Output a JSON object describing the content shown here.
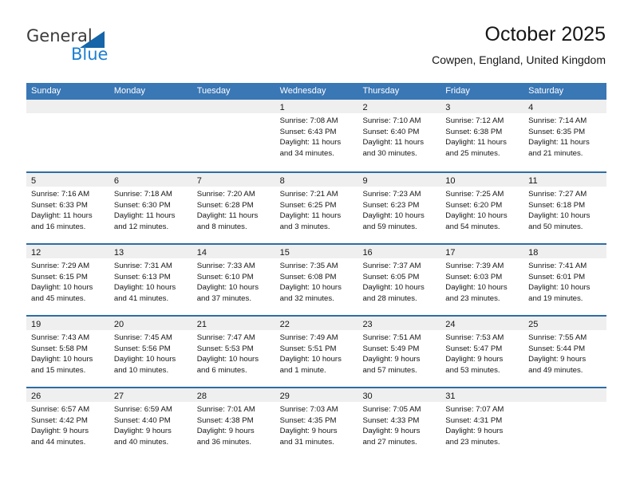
{
  "brand": {
    "line1": "General",
    "line2": "Blue",
    "triangle_color": "#1565a8",
    "blue_color": "#1d7fd0"
  },
  "header": {
    "title": "October 2025",
    "subtitle": "Cowpen, England, United Kingdom"
  },
  "theme": {
    "header_bg": "#3a77b5",
    "row_rule": "#2e6da4",
    "date_band": "#efefef"
  },
  "weekday_headers": [
    "Sunday",
    "Monday",
    "Tuesday",
    "Wednesday",
    "Thursday",
    "Friday",
    "Saturday"
  ],
  "weeks": [
    [
      {
        "day": "",
        "blank": true
      },
      {
        "day": "",
        "blank": true
      },
      {
        "day": "",
        "blank": true
      },
      {
        "day": "1",
        "sunrise": "Sunrise: 7:08 AM",
        "sunset": "Sunset: 6:43 PM",
        "daylight1": "Daylight: 11 hours",
        "daylight2": "and 34 minutes."
      },
      {
        "day": "2",
        "sunrise": "Sunrise: 7:10 AM",
        "sunset": "Sunset: 6:40 PM",
        "daylight1": "Daylight: 11 hours",
        "daylight2": "and 30 minutes."
      },
      {
        "day": "3",
        "sunrise": "Sunrise: 7:12 AM",
        "sunset": "Sunset: 6:38 PM",
        "daylight1": "Daylight: 11 hours",
        "daylight2": "and 25 minutes."
      },
      {
        "day": "4",
        "sunrise": "Sunrise: 7:14 AM",
        "sunset": "Sunset: 6:35 PM",
        "daylight1": "Daylight: 11 hours",
        "daylight2": "and 21 minutes."
      }
    ],
    [
      {
        "day": "5",
        "sunrise": "Sunrise: 7:16 AM",
        "sunset": "Sunset: 6:33 PM",
        "daylight1": "Daylight: 11 hours",
        "daylight2": "and 16 minutes."
      },
      {
        "day": "6",
        "sunrise": "Sunrise: 7:18 AM",
        "sunset": "Sunset: 6:30 PM",
        "daylight1": "Daylight: 11 hours",
        "daylight2": "and 12 minutes."
      },
      {
        "day": "7",
        "sunrise": "Sunrise: 7:20 AM",
        "sunset": "Sunset: 6:28 PM",
        "daylight1": "Daylight: 11 hours",
        "daylight2": "and 8 minutes."
      },
      {
        "day": "8",
        "sunrise": "Sunrise: 7:21 AM",
        "sunset": "Sunset: 6:25 PM",
        "daylight1": "Daylight: 11 hours",
        "daylight2": "and 3 minutes."
      },
      {
        "day": "9",
        "sunrise": "Sunrise: 7:23 AM",
        "sunset": "Sunset: 6:23 PM",
        "daylight1": "Daylight: 10 hours",
        "daylight2": "and 59 minutes."
      },
      {
        "day": "10",
        "sunrise": "Sunrise: 7:25 AM",
        "sunset": "Sunset: 6:20 PM",
        "daylight1": "Daylight: 10 hours",
        "daylight2": "and 54 minutes."
      },
      {
        "day": "11",
        "sunrise": "Sunrise: 7:27 AM",
        "sunset": "Sunset: 6:18 PM",
        "daylight1": "Daylight: 10 hours",
        "daylight2": "and 50 minutes."
      }
    ],
    [
      {
        "day": "12",
        "sunrise": "Sunrise: 7:29 AM",
        "sunset": "Sunset: 6:15 PM",
        "daylight1": "Daylight: 10 hours",
        "daylight2": "and 45 minutes."
      },
      {
        "day": "13",
        "sunrise": "Sunrise: 7:31 AM",
        "sunset": "Sunset: 6:13 PM",
        "daylight1": "Daylight: 10 hours",
        "daylight2": "and 41 minutes."
      },
      {
        "day": "14",
        "sunrise": "Sunrise: 7:33 AM",
        "sunset": "Sunset: 6:10 PM",
        "daylight1": "Daylight: 10 hours",
        "daylight2": "and 37 minutes."
      },
      {
        "day": "15",
        "sunrise": "Sunrise: 7:35 AM",
        "sunset": "Sunset: 6:08 PM",
        "daylight1": "Daylight: 10 hours",
        "daylight2": "and 32 minutes."
      },
      {
        "day": "16",
        "sunrise": "Sunrise: 7:37 AM",
        "sunset": "Sunset: 6:05 PM",
        "daylight1": "Daylight: 10 hours",
        "daylight2": "and 28 minutes."
      },
      {
        "day": "17",
        "sunrise": "Sunrise: 7:39 AM",
        "sunset": "Sunset: 6:03 PM",
        "daylight1": "Daylight: 10 hours",
        "daylight2": "and 23 minutes."
      },
      {
        "day": "18",
        "sunrise": "Sunrise: 7:41 AM",
        "sunset": "Sunset: 6:01 PM",
        "daylight1": "Daylight: 10 hours",
        "daylight2": "and 19 minutes."
      }
    ],
    [
      {
        "day": "19",
        "sunrise": "Sunrise: 7:43 AM",
        "sunset": "Sunset: 5:58 PM",
        "daylight1": "Daylight: 10 hours",
        "daylight2": "and 15 minutes."
      },
      {
        "day": "20",
        "sunrise": "Sunrise: 7:45 AM",
        "sunset": "Sunset: 5:56 PM",
        "daylight1": "Daylight: 10 hours",
        "daylight2": "and 10 minutes."
      },
      {
        "day": "21",
        "sunrise": "Sunrise: 7:47 AM",
        "sunset": "Sunset: 5:53 PM",
        "daylight1": "Daylight: 10 hours",
        "daylight2": "and 6 minutes."
      },
      {
        "day": "22",
        "sunrise": "Sunrise: 7:49 AM",
        "sunset": "Sunset: 5:51 PM",
        "daylight1": "Daylight: 10 hours",
        "daylight2": "and 1 minute."
      },
      {
        "day": "23",
        "sunrise": "Sunrise: 7:51 AM",
        "sunset": "Sunset: 5:49 PM",
        "daylight1": "Daylight: 9 hours",
        "daylight2": "and 57 minutes."
      },
      {
        "day": "24",
        "sunrise": "Sunrise: 7:53 AM",
        "sunset": "Sunset: 5:47 PM",
        "daylight1": "Daylight: 9 hours",
        "daylight2": "and 53 minutes."
      },
      {
        "day": "25",
        "sunrise": "Sunrise: 7:55 AM",
        "sunset": "Sunset: 5:44 PM",
        "daylight1": "Daylight: 9 hours",
        "daylight2": "and 49 minutes."
      }
    ],
    [
      {
        "day": "26",
        "sunrise": "Sunrise: 6:57 AM",
        "sunset": "Sunset: 4:42 PM",
        "daylight1": "Daylight: 9 hours",
        "daylight2": "and 44 minutes."
      },
      {
        "day": "27",
        "sunrise": "Sunrise: 6:59 AM",
        "sunset": "Sunset: 4:40 PM",
        "daylight1": "Daylight: 9 hours",
        "daylight2": "and 40 minutes."
      },
      {
        "day": "28",
        "sunrise": "Sunrise: 7:01 AM",
        "sunset": "Sunset: 4:38 PM",
        "daylight1": "Daylight: 9 hours",
        "daylight2": "and 36 minutes."
      },
      {
        "day": "29",
        "sunrise": "Sunrise: 7:03 AM",
        "sunset": "Sunset: 4:35 PM",
        "daylight1": "Daylight: 9 hours",
        "daylight2": "and 31 minutes."
      },
      {
        "day": "30",
        "sunrise": "Sunrise: 7:05 AM",
        "sunset": "Sunset: 4:33 PM",
        "daylight1": "Daylight: 9 hours",
        "daylight2": "and 27 minutes."
      },
      {
        "day": "31",
        "sunrise": "Sunrise: 7:07 AM",
        "sunset": "Sunset: 4:31 PM",
        "daylight1": "Daylight: 9 hours",
        "daylight2": "and 23 minutes."
      },
      {
        "day": "",
        "blank": true
      }
    ]
  ]
}
